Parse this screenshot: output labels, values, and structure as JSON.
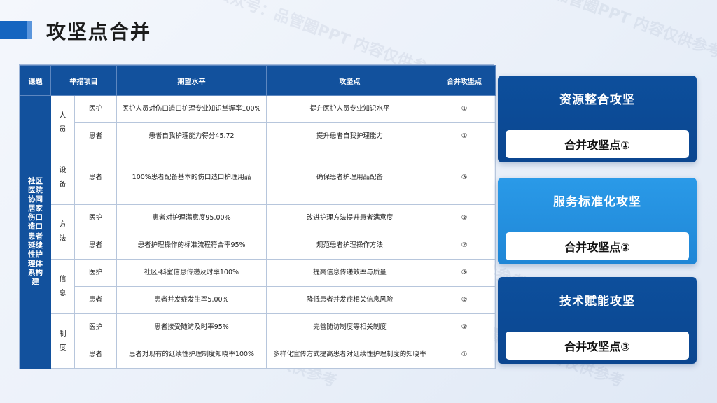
{
  "page": {
    "title": "攻坚点合并"
  },
  "watermark": "公众号：品管圈PPT  内容仅供参考",
  "table": {
    "headers": [
      "课题",
      "举措项目",
      "期望水平",
      "攻坚点",
      "合并攻坚点"
    ],
    "topic": "社区医院协同居家伤口造口患者延续性护理体系构建",
    "groups": {
      "g1": "人员",
      "g2": "设备",
      "g3": "方法",
      "g4": "信息",
      "g5": "制度"
    },
    "rows": [
      {
        "target": "医护",
        "expect": "医护人员对伤口造口护理专业知识掌握率100%",
        "point": "提升医护人员专业知识水平",
        "merge": "①"
      },
      {
        "target": "患者",
        "expect": "患者自我护理能力得分45.72",
        "point": "提升患者自我护理能力",
        "merge": "①"
      },
      {
        "target": "患者",
        "expect": "100%患者配备基本的伤口造口护理用品",
        "point": "确保患者护理用品配备",
        "merge": "③"
      },
      {
        "target": "医护",
        "expect": "患者对护理满意度95.00%",
        "point": "改进护理方法提升患者满意度",
        "merge": "②"
      },
      {
        "target": "患者",
        "expect": "患者护理操作的标准流程符合率95%",
        "point": "规范患者护理操作方法",
        "merge": "②"
      },
      {
        "target": "医护",
        "expect": "社区-科室信息传递及时率100%",
        "point": "提高信息传递效率与质量",
        "merge": "③"
      },
      {
        "target": "患者",
        "expect": "患者并发症发生率5.00%",
        "point": "降低患者并发症相关信息风险",
        "merge": "②"
      },
      {
        "target": "医护",
        "expect": "患者接受随访及时率95%",
        "point": "完善随访制度等相关制度",
        "merge": "②"
      },
      {
        "target": "患者",
        "expect": "患者对现有的延续性护理制度知晓率100%",
        "point": "多样化宣传方式提高患者对延续性护理制度的知晓率",
        "merge": "①"
      }
    ]
  },
  "cards": [
    {
      "title": "资源整合攻坚",
      "label": "合并攻坚点①"
    },
    {
      "title": "服务标准化攻坚",
      "label": "合并攻坚点②"
    },
    {
      "title": "技术赋能攻坚",
      "label": "合并攻坚点③"
    }
  ],
  "colors": {
    "dark_blue": "#12519d",
    "light_blue": "#1f86d6",
    "accent": "#1565c0"
  }
}
